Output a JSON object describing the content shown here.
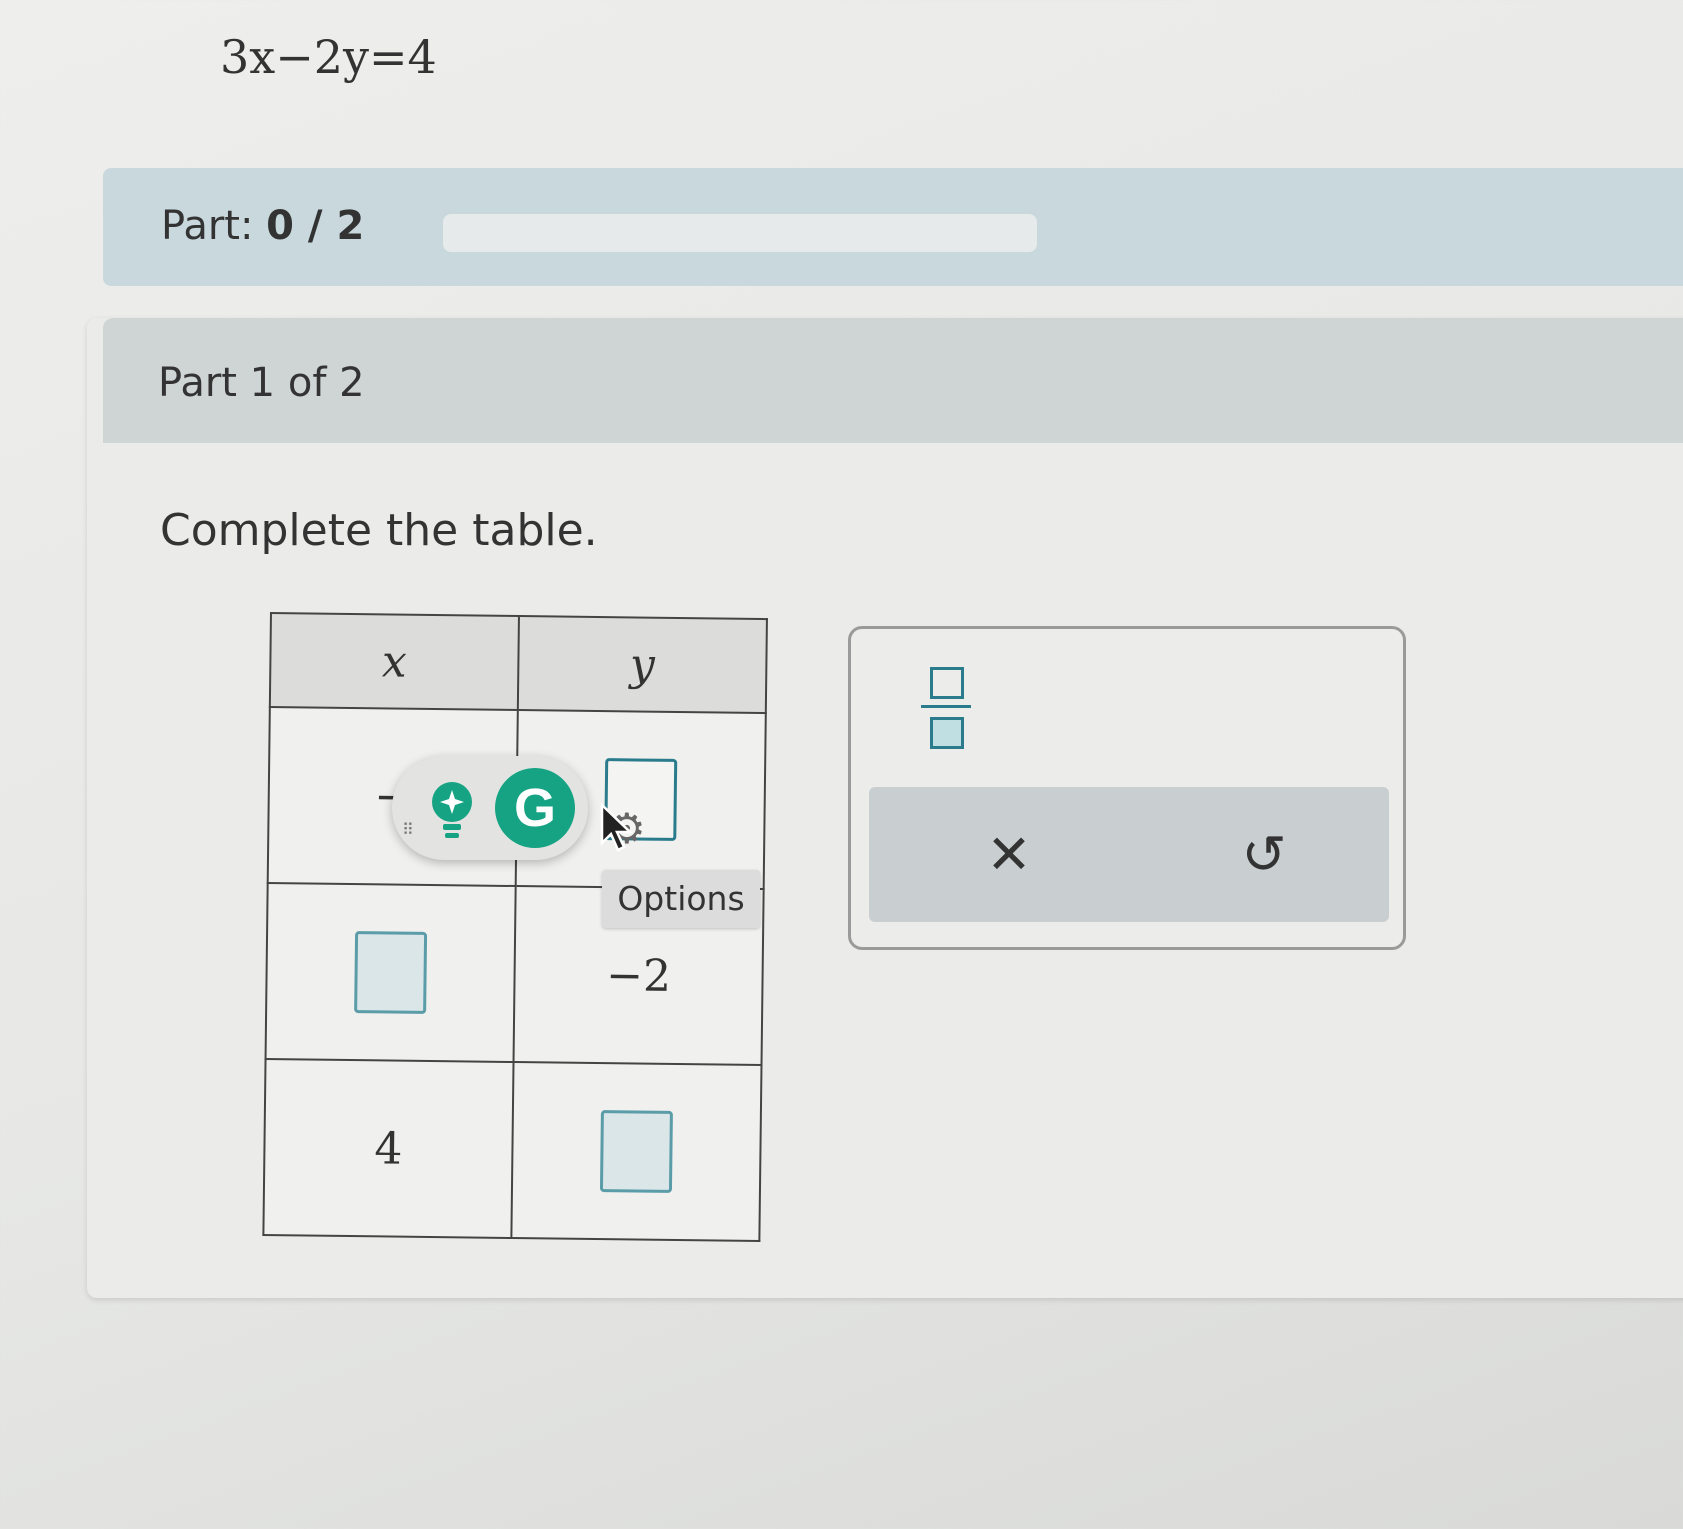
{
  "equation": "3x−2y=4",
  "progress": {
    "label": "Part:",
    "value": "0 / 2",
    "completed_fraction": 0
  },
  "question": {
    "header": "Part 1 of 2",
    "instruction": "Complete the table."
  },
  "table": {
    "headers": [
      "x",
      "y"
    ],
    "rows": [
      {
        "x": "−",
        "y": ""
      },
      {
        "x": "",
        "y": "−2"
      },
      {
        "x": "4",
        "y": ""
      }
    ]
  },
  "toolbox": {
    "fraction_icon": "fraction-icon",
    "clear_symbol": "✕",
    "undo_symbol": "↺"
  },
  "grammarly": {
    "g_letter": "G"
  },
  "tooltip": "Options",
  "colors": {
    "accent": "#2a7c8c",
    "progress_bar_bg": "#c8d8dd",
    "grammarly_green": "#15a383"
  }
}
